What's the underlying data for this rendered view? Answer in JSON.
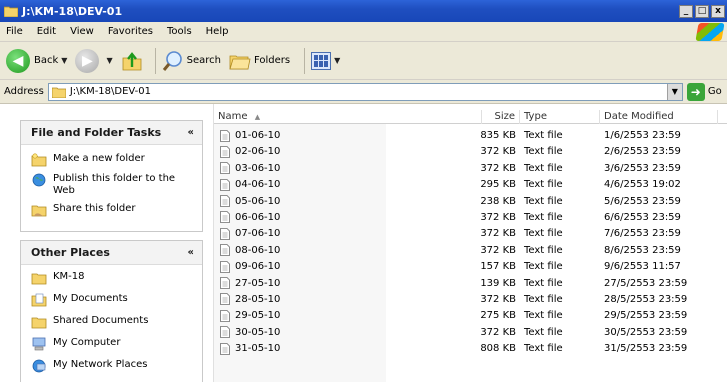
{
  "window": {
    "title": "J:\\KM-18\\DEV-01",
    "buttons": {
      "minimize": "_",
      "restore": "□",
      "close": "x"
    }
  },
  "menu": [
    "File",
    "Edit",
    "View",
    "Favorites",
    "Tools",
    "Help"
  ],
  "toolbar": {
    "back_label": "Back",
    "search_label": "Search",
    "folders_label": "Folders"
  },
  "address": {
    "label": "Address",
    "value": "J:\\KM-18\\DEV-01",
    "go_label": "Go"
  },
  "tasks_panel": {
    "title": "File and Folder Tasks",
    "items": [
      "Make a new folder",
      "Publish this folder to the Web",
      "Share this folder"
    ]
  },
  "places_panel": {
    "title": "Other Places",
    "items": [
      "KM-18",
      "My Documents",
      "Shared Documents",
      "My Computer",
      "My Network Places"
    ]
  },
  "columns": {
    "name": "Name",
    "size": "Size",
    "type": "Type",
    "date": "Date Modified"
  },
  "files": [
    {
      "name": "01-06-10",
      "size": "835 KB",
      "type": "Text file",
      "date": "1/6/2553 23:59"
    },
    {
      "name": "02-06-10",
      "size": "372 KB",
      "type": "Text file",
      "date": "2/6/2553 23:59"
    },
    {
      "name": "03-06-10",
      "size": "372 KB",
      "type": "Text file",
      "date": "3/6/2553 23:59"
    },
    {
      "name": "04-06-10",
      "size": "295 KB",
      "type": "Text file",
      "date": "4/6/2553 19:02"
    },
    {
      "name": "05-06-10",
      "size": "238 KB",
      "type": "Text file",
      "date": "5/6/2553 23:59"
    },
    {
      "name": "06-06-10",
      "size": "372 KB",
      "type": "Text file",
      "date": "6/6/2553 23:59"
    },
    {
      "name": "07-06-10",
      "size": "372 KB",
      "type": "Text file",
      "date": "7/6/2553 23:59"
    },
    {
      "name": "08-06-10",
      "size": "372 KB",
      "type": "Text file",
      "date": "8/6/2553 23:59"
    },
    {
      "name": "09-06-10",
      "size": "157 KB",
      "type": "Text file",
      "date": "9/6/2553 11:57"
    },
    {
      "name": "27-05-10",
      "size": "139 KB",
      "type": "Text file",
      "date": "27/5/2553 23:59"
    },
    {
      "name": "28-05-10",
      "size": "372 KB",
      "type": "Text file",
      "date": "28/5/2553 23:59"
    },
    {
      "name": "29-05-10",
      "size": "275 KB",
      "type": "Text file",
      "date": "29/5/2553 23:59"
    },
    {
      "name": "30-05-10",
      "size": "372 KB",
      "type": "Text file",
      "date": "30/5/2553 23:59"
    },
    {
      "name": "31-05-10",
      "size": "808 KB",
      "type": "Text file",
      "date": "31/5/2553 23:59"
    }
  ]
}
